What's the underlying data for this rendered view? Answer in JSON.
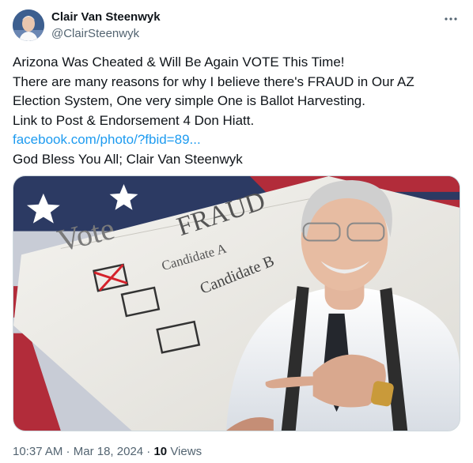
{
  "author": {
    "name": "Clair Van Steenwyk",
    "handle": "@ClairSteenwyk"
  },
  "tweet": {
    "lines": [
      "Arizona Was Cheated & Will Be Again VOTE This Time!",
      "There are many reasons for why I believe there's FRAUD in Our AZ",
      "Election System, One very simple One is Ballot Harvesting.",
      "Link to Post & Endorsement 4 Don Hiatt."
    ],
    "link": "facebook.com/photo/?fbid=89...",
    "closing": "God Bless You All; Clair Van Steenwyk"
  },
  "media": {
    "ballot_vote": "Vote",
    "ballot_fraud": "FRAUD",
    "ballot_candidate_a": "Candidate A",
    "ballot_candidate_b": "Candidate B"
  },
  "meta": {
    "time": "10:37 AM",
    "separator": " · ",
    "date": "Mar 18, 2024",
    "views_count": "10",
    "views_label": " Views"
  },
  "icons": {
    "more": "more-horizontal-icon"
  },
  "colors": {
    "link": "#1d9bf0",
    "secondary_text": "#536471",
    "primary_text": "#0f1419"
  }
}
